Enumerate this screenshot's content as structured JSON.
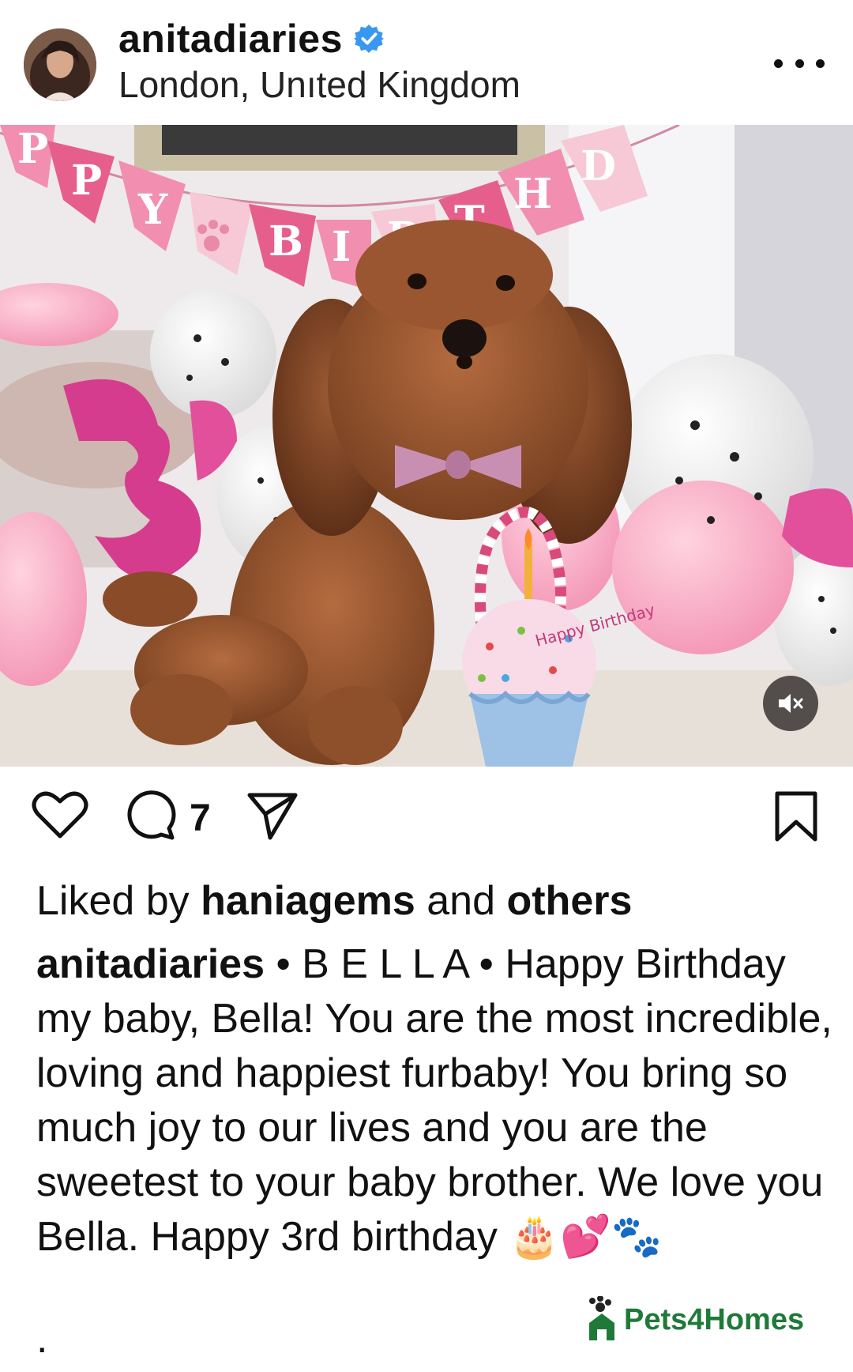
{
  "post": {
    "username": "anitadiaries",
    "location": "London, Unıted Kingdom",
    "verified": true,
    "comment_count": "7",
    "liked_by_prefix": "Liked by",
    "liked_by_user": "haniagems",
    "liked_by_middle": "and",
    "liked_by_suffix": "others",
    "caption_user": "anitadiaries",
    "caption_text": " • B E L L A • Happy Birthday my baby, Bella! You are the most incredible, loving and happiest furbaby! You bring so much joy to our lives and you are the sweetest to your baby brother. We love you Bella. Happy 3rd birthday 🎂💕🐾",
    "caption_trailing": "."
  },
  "photo": {
    "banner_text": "PPY BIRTHD",
    "cupcake_text": "Happy Birthday"
  },
  "watermark": {
    "text": "Pets4Homes"
  },
  "icons": {
    "avatar": "avatar",
    "verified": "verified-badge-icon",
    "more": "more-options-icon",
    "like": "heart-icon",
    "comment": "comment-icon",
    "share": "send-icon",
    "save": "bookmark-icon",
    "mute": "muted-speaker-icon"
  },
  "colors": {
    "verified_blue": "#3897f0",
    "text": "#111111",
    "watermark_green": "#1f7a3a"
  }
}
